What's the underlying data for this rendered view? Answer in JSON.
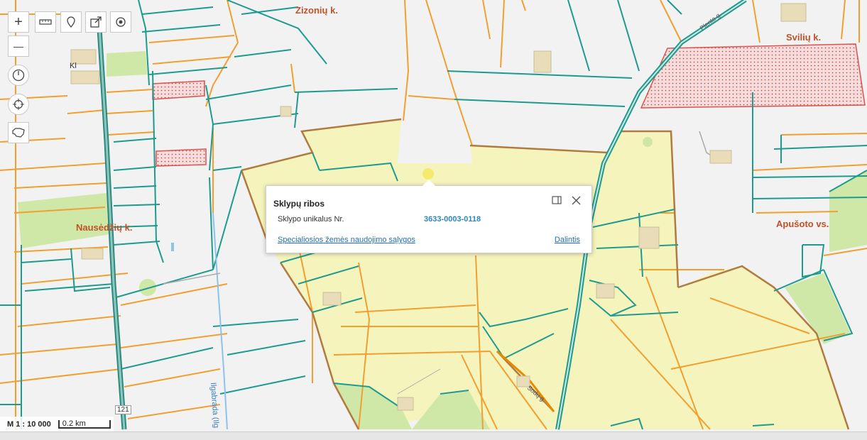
{
  "map": {
    "labels": {
      "zizoniu": "Zizonių k.",
      "sviliu": "Svilių k.",
      "nauseiziu": "Nausėdžių k.",
      "apusoto": "Apušoto vs.",
      "klo": "Kl",
      "stream": "Ilgabrada (Ilg",
      "plento": "Plento g.",
      "sodu": "Sodų g.",
      "road_number": "121"
    },
    "colors": {
      "background": "#f2f2f2",
      "parcel_fill": "#f5f4bc",
      "orange_line": "#f0a030",
      "teal_line": "#1f9a8e",
      "brown_line": "#b07a40",
      "green_fill": "#cfe8a8",
      "red_hatch": "#d9534f"
    }
  },
  "toolbar": {
    "zoom_in": "+",
    "zoom_out": "—"
  },
  "popup": {
    "title": "Sklypų ribos",
    "label": "Sklypo unikalus Nr.",
    "value": "3633-0003-0118",
    "link_special": "Specialiosios žemės naudojimo sąlygos",
    "link_share": "Dalintis"
  },
  "scale": {
    "ratio": "M 1 : 10 000",
    "bar": "0.2 km"
  }
}
